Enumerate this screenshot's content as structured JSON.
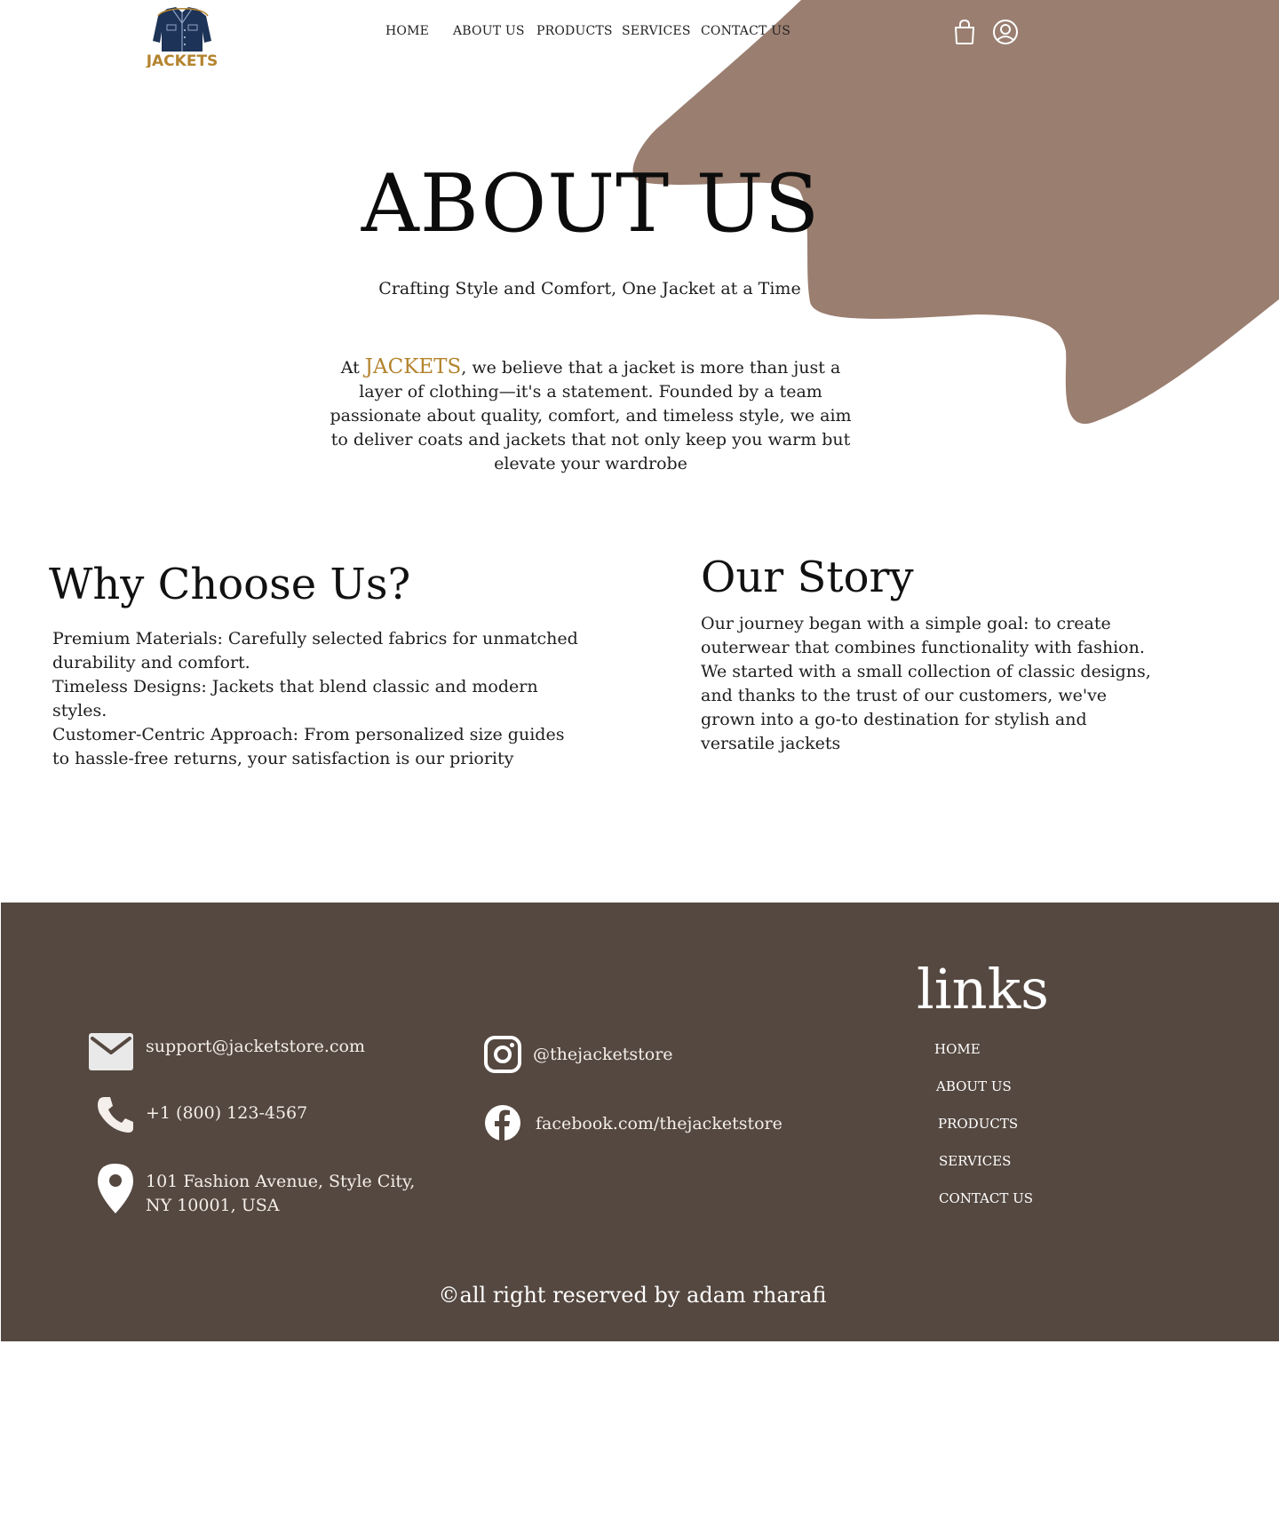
{
  "brand": {
    "logo_text": "JACKETS",
    "accent_color": "#b4842e",
    "navy_color": "#1d3357"
  },
  "nav": {
    "items": [
      {
        "label": "HOME"
      },
      {
        "label": "ABOUT US"
      },
      {
        "label": "PRODUCTS"
      },
      {
        "label": "SERVICES"
      },
      {
        "label": "CONTACT US"
      }
    ],
    "icons": [
      "shopping-bag-icon",
      "user-account-icon"
    ]
  },
  "colors": {
    "blob": "#9a7e70",
    "footer_bg": "#554840",
    "text": "#1e1e1e"
  },
  "hero": {
    "title": "ABOUT US",
    "subtitle": "Crafting Style and Comfort, One Jacket at a Time",
    "intro_prefix": "At ",
    "intro_brand": "JACKETS",
    "intro_rest": ", we believe that a jacket is more than just a layer of clothing—it's a statement. Founded by a team passionate about quality, comfort, and timeless style, we aim to deliver coats and jackets that not only keep you warm but elevate your wardrobe"
  },
  "why": {
    "title": "Why Choose Us?",
    "items": [
      "Premium Materials: Carefully selected fabrics for unmatched durability and comfort.",
      "Timeless Designs: Jackets that blend classic and modern styles.",
      "Customer-Centric Approach: From personalized size guides to hassle-free returns, your satisfaction is our priority"
    ]
  },
  "story": {
    "title": "Our Story",
    "text": "Our journey began with a simple goal: to create outerwear that combines functionality with fashion. We started with a small collection of classic designs, and thanks to the trust of our customers, we've grown into a go-to destination for stylish and versatile jackets"
  },
  "footer": {
    "contact": {
      "email": "support@jacketstore.com",
      "phone": "+1 (800) 123-4567",
      "address": "101 Fashion Avenue, Style City, NY 10001, USA"
    },
    "social": {
      "instagram": "@thejacketstore",
      "facebook": "facebook.com/thejacketstore"
    },
    "links_title": "links",
    "links": [
      {
        "label": "HOME"
      },
      {
        "label": "ABOUT US"
      },
      {
        "label": "PRODUCTS"
      },
      {
        "label": "SERVICES"
      },
      {
        "label": "CONTACT US"
      }
    ],
    "copyright": "©all right reserved by adam rharafi"
  }
}
